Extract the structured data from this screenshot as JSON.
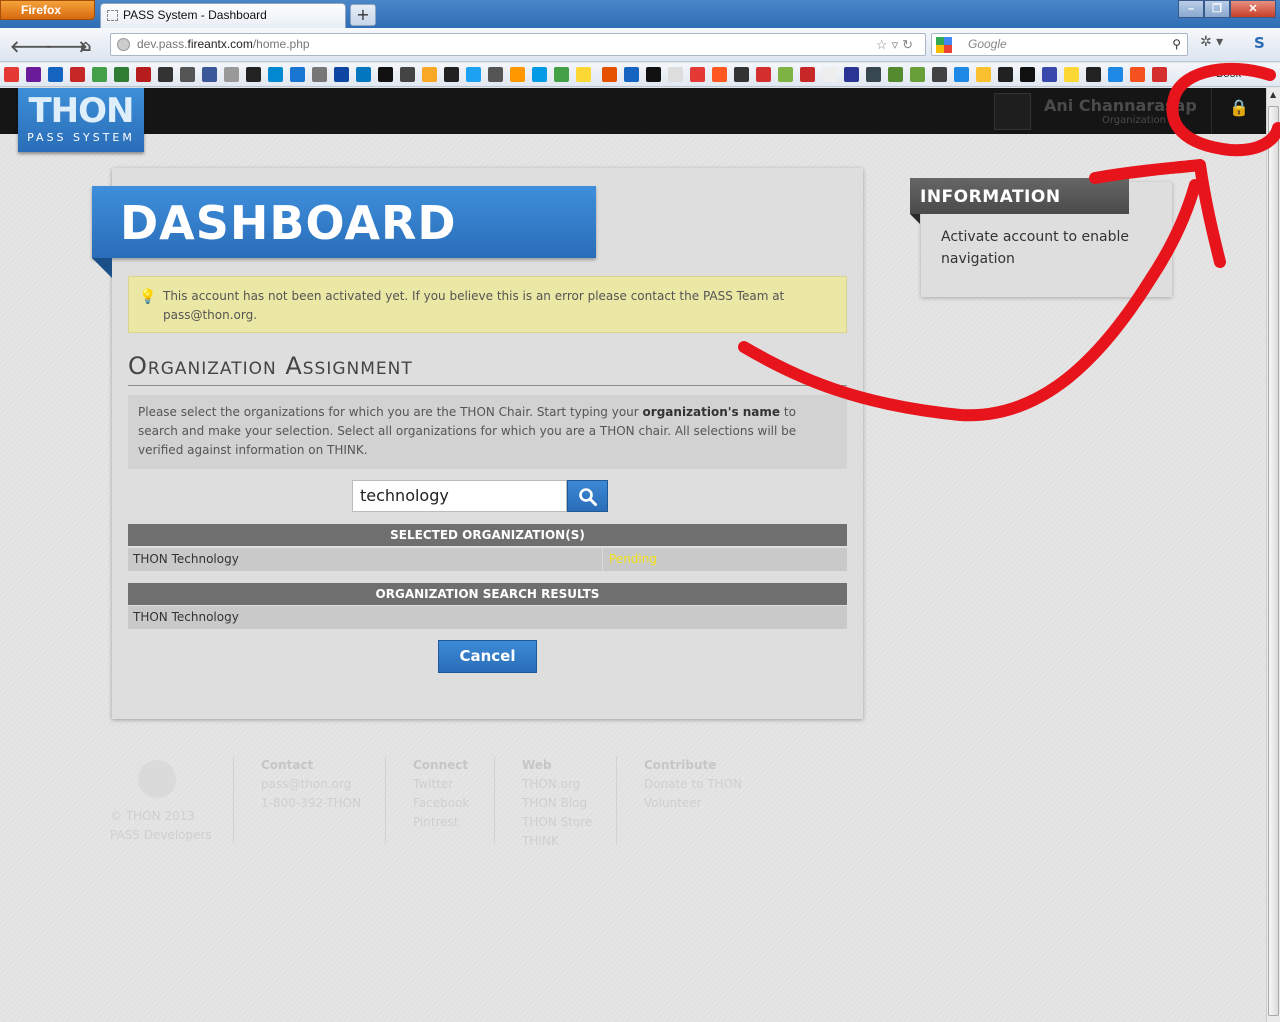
{
  "browser": {
    "menu_button": "Firefox",
    "tab_title": "PASS System - Dashboard",
    "new_tab": "+",
    "url_prefix": "dev.pass.",
    "url_domain": "fireantx.com",
    "url_path": "/home.php",
    "search_placeholder": "Google",
    "bookmarks_label": "Book",
    "window_min": "–",
    "window_max": "❐",
    "window_close": "✕"
  },
  "header": {
    "logo_main": "THON",
    "logo_sub": "PASS SYSTEM",
    "user_name": "Ani Channarasap",
    "user_role": "Organization Di"
  },
  "main": {
    "page_title": "DASHBOARD",
    "alert_text": "This account has not been activated yet. If you believe this is an error please contact the PASS Team at pass@thon.org.",
    "section_title": "Organization Assignment",
    "instructions_pre": "Please select the organizations for which you are the THON Chair. Start typing your ",
    "instructions_bold": "organization's name",
    "instructions_post": " to search and make your selection. Select all organizations for which you are a THON chair. All selections will be verified against information on THINK.",
    "search_value": "technology",
    "selected_header": "SELECTED ORGANIZATION(S)",
    "selected_rows": [
      {
        "name": "THON Technology",
        "status": "Pending"
      }
    ],
    "results_header": "ORGANIZATION SEARCH RESULTS",
    "results_rows": [
      {
        "name": "THON Technology"
      }
    ],
    "cancel_label": "Cancel"
  },
  "sidebar": {
    "info_title": "INFORMATION",
    "info_text": "Activate account to enable navigation"
  },
  "footer": {
    "copyright": "© THON 2013",
    "developers": "PASS Developers",
    "columns": [
      {
        "title": "Contact",
        "links": [
          "pass@thon.org",
          "1-800-392-THON"
        ]
      },
      {
        "title": "Connect",
        "links": [
          "Twitter",
          "Facebook",
          "Pintrest"
        ]
      },
      {
        "title": "Web",
        "links": [
          "THON.org",
          "THON Blog",
          "THON Store",
          "THINK"
        ]
      },
      {
        "title": "Contribute",
        "links": [
          "Donate to THON",
          "Volunteer"
        ]
      }
    ]
  },
  "colors": {
    "brand_blue": "#2a6db8",
    "pending_yellow": "#f5e31a",
    "annotation_red": "#e8141c"
  }
}
